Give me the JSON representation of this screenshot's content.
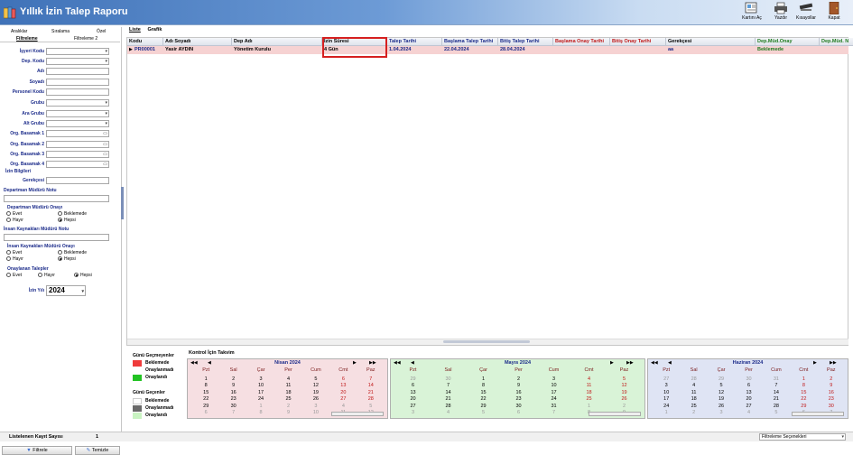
{
  "app": {
    "title": "Yıllık İzin Talep Raporu",
    "title_color": "#ffffff",
    "accent": "#3f72b8"
  },
  "toolbar": {
    "open_card": "Kartını Aç",
    "print": "Yazdır",
    "shortcuts": "Kısayollar",
    "close": "Kapat"
  },
  "left_tabs": {
    "row1": [
      "Aralıklar",
      "Sıralama",
      "Özel"
    ],
    "row2": [
      "Filtreleme",
      "Filtreleme 2"
    ]
  },
  "filters": [
    {
      "label": "İşyeri Kodu",
      "dropdown": true
    },
    {
      "label": "Dep. Kodu",
      "dropdown": true
    },
    {
      "label": "Adı",
      "dropdown": false
    },
    {
      "label": "Soyadı",
      "dropdown": false
    },
    {
      "label": "Personel Kodu",
      "dropdown": false
    },
    {
      "label": "Grubu",
      "dropdown": true
    },
    {
      "label": "Ara Grubu",
      "dropdown": true
    },
    {
      "label": "Alt Grubu",
      "dropdown": true
    },
    {
      "label": "Org. Basamak 1",
      "dropdown": true
    },
    {
      "label": "Org. Basamak 2",
      "dropdown": true
    },
    {
      "label": "Org. Basamak 3",
      "dropdown": true
    },
    {
      "label": "Org. Basamak 4",
      "dropdown": true
    }
  ],
  "leave_info": {
    "section_label": "İzin Bilgileri",
    "reason_label": "Gerekçesi",
    "dept_manager_note": "Departman Müdürü Notu",
    "dept_manager_approval": "Departman Müdürü Onayı",
    "hr_note": "İnsan Kaynakları Müdürü Notu",
    "hr_approval": "İnsan Kaynakları Müdürü Onayı",
    "approved_requests": "Onaylanan Talepler",
    "opt_yes": "Evet",
    "opt_no": "Hayır",
    "opt_pending": "Beklemede",
    "opt_all": "Hepsi",
    "year_label": "İzin Yılı",
    "year_value": "2024"
  },
  "left_buttons": {
    "filter": "Filtrele",
    "clear": "Temizle"
  },
  "right_tabs": [
    "Liste",
    "Grafik"
  ],
  "table": {
    "headers": [
      "Kodu",
      "Adı Soyadı",
      "Dep Adı",
      "İzin Süresi",
      "Talep Tarihi",
      "Başlama Talep Tarihi",
      "Bitiş Talep Tarihi",
      "Başlama Onay Tarihi",
      "Bitiş Onay Tarihi",
      "Gerekçesi",
      "Dep.Müd.Onay",
      "Dep.Müd. N"
    ],
    "header_colors": [
      "#000000",
      "#000000",
      "#000000",
      "#000000",
      "#1b2b8a",
      "#1b2b8a",
      "#1b2b8a",
      "#c01818",
      "#c01818",
      "#000000",
      "#1f7a1f",
      "#1f7a1f"
    ],
    "rows": [
      [
        "PR00001",
        "Yasir AYDIN",
        "Yönetim Kurulu",
        "4 Gün",
        "1.04.2024",
        "22.04.2024",
        "28.04.2024",
        "",
        "",
        "aa",
        "Beklemede",
        ""
      ]
    ],
    "row_colors": [
      "#1b2b8a",
      "#000000",
      "#000000",
      "#000000",
      "#1b2b8a",
      "#1b2b8a",
      "#1b2b8a",
      "#c01818",
      "#c01818",
      "#1b2b8a",
      "#1f7a1f",
      "#1f7a1f"
    ]
  },
  "calendar": {
    "title": "Kontrol İçin Takvim",
    "legend_past": "Günü Geçmeyenler",
    "legend_future": "Günü Geçenler",
    "pending": "Beklemede",
    "rejected": "Onaylanmadı",
    "approved": "Onaylandı",
    "dow": [
      "Pzt",
      "Sal",
      "Çar",
      "Per",
      "Cum",
      "Cmt",
      "Paz"
    ],
    "months": [
      {
        "name": "Nisan 2024",
        "bg": "#f6dfe2",
        "weeks": [
          [
            "1",
            "2",
            "3",
            "4",
            "5",
            "6",
            "7"
          ],
          [
            "8",
            "9",
            "10",
            "11",
            "12",
            "13",
            "14"
          ],
          [
            "15",
            "16",
            "17",
            "18",
            "19",
            "20",
            "21"
          ],
          [
            "22",
            "23",
            "24",
            "25",
            "26",
            "27",
            "28"
          ],
          [
            "29",
            "30",
            "1",
            "2",
            "3",
            "4",
            "5"
          ],
          [
            "6",
            "7",
            "8",
            "9",
            "10",
            "11",
            "12"
          ]
        ],
        "first": 0,
        "len": 30
      },
      {
        "name": "Mayıs 2024",
        "bg": "#d9f3d7",
        "weeks": [
          [
            "29",
            "30",
            "1",
            "2",
            "3",
            "4",
            "5"
          ],
          [
            "6",
            "7",
            "8",
            "9",
            "10",
            "11",
            "12"
          ],
          [
            "13",
            "14",
            "15",
            "16",
            "17",
            "18",
            "19"
          ],
          [
            "20",
            "21",
            "22",
            "23",
            "24",
            "25",
            "26"
          ],
          [
            "27",
            "28",
            "29",
            "30",
            "31",
            "1",
            "2"
          ],
          [
            "3",
            "4",
            "5",
            "6",
            "7",
            "8",
            "9"
          ]
        ],
        "first": 2,
        "len": 31
      },
      {
        "name": "Haziran 2024",
        "bg": "#dfe4f4",
        "weeks": [
          [
            "27",
            "28",
            "29",
            "30",
            "31",
            "1",
            "2"
          ],
          [
            "3",
            "4",
            "5",
            "6",
            "7",
            "8",
            "9"
          ],
          [
            "10",
            "11",
            "12",
            "13",
            "14",
            "15",
            "16"
          ],
          [
            "17",
            "18",
            "19",
            "20",
            "21",
            "22",
            "23"
          ],
          [
            "24",
            "25",
            "26",
            "27",
            "28",
            "29",
            "30"
          ],
          [
            "1",
            "2",
            "3",
            "4",
            "5",
            "6",
            "7"
          ]
        ],
        "first": 5,
        "len": 30
      }
    ]
  },
  "status": {
    "record_label": "Listelenen Kayıt Sayısı",
    "record_count": "1",
    "filter_options": "Filtreleme Seçenekleri"
  },
  "colors": {
    "pending_past": "#ef3b3b",
    "approved_past": "#22c323",
    "pending_future": "#ffffff",
    "rejected_future": "#6a6a6a",
    "approved_future": "#c9f3c2",
    "highlight_box": "#d62020"
  }
}
